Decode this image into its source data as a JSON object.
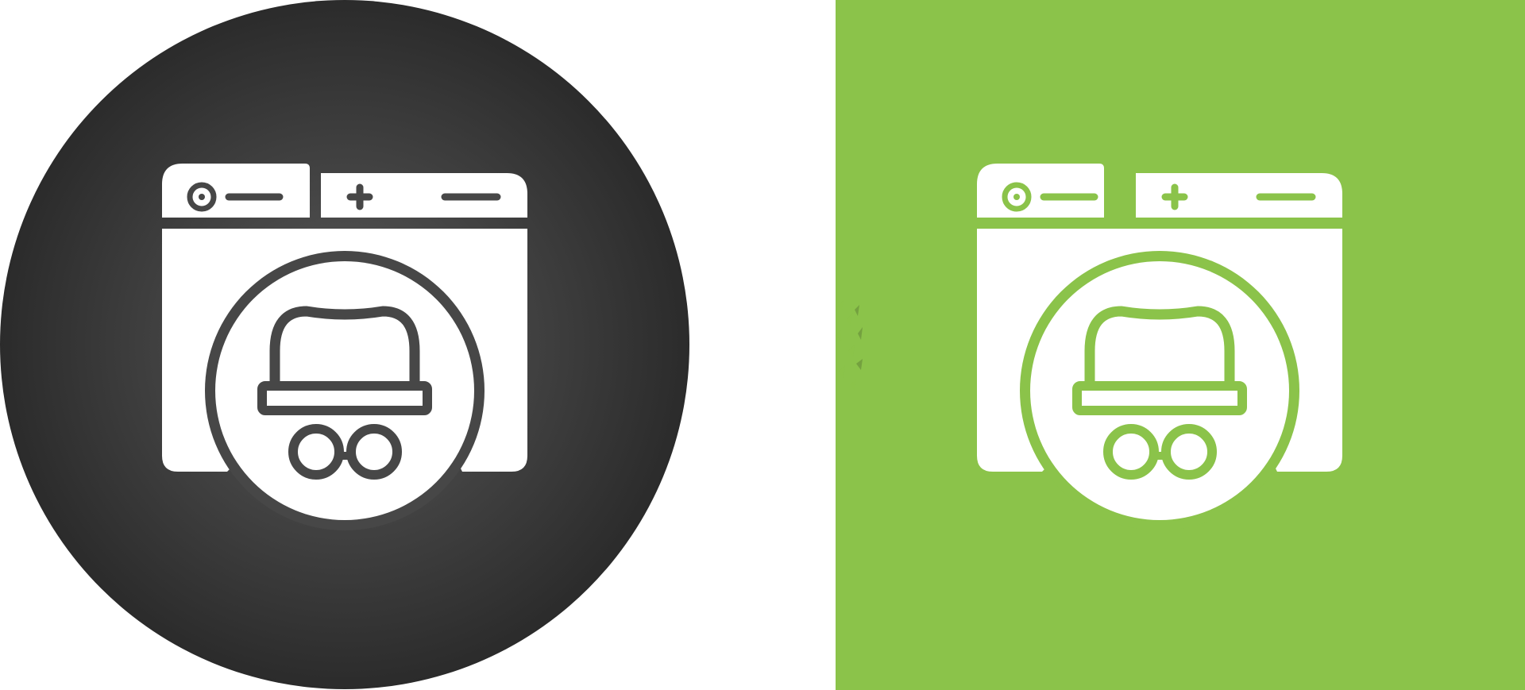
{
  "colors": {
    "background": "#ffffff",
    "dark_badge_center": "#5a5a5a",
    "dark_badge_edge": "#2b2b2b",
    "green_panel": "#8bc34a",
    "icon_fill": "#ffffff",
    "dark_stroke": "#474747",
    "green_stroke": "#8bc34a"
  },
  "variants": [
    {
      "name": "dark-circle",
      "icon": "incognito-browser-icon"
    },
    {
      "name": "green-square",
      "icon": "incognito-browser-icon"
    }
  ]
}
